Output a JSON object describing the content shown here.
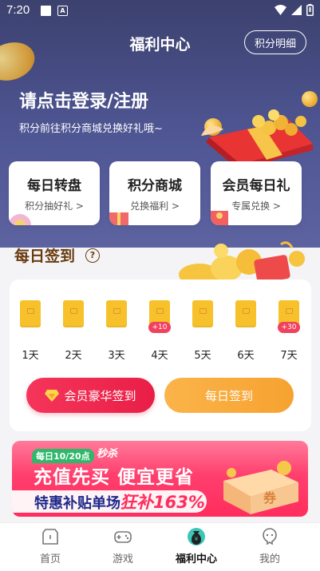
{
  "status": {
    "time": "7:20",
    "a_icon_letter": "A"
  },
  "header": {
    "title": "福利中心",
    "points_detail": "积分明细"
  },
  "login": {
    "title": "请点击登录/注册",
    "subtitle": "积分前往积分商城兑换好礼哦~"
  },
  "feature_cards": [
    {
      "title": "每日转盘",
      "sub": "积分抽好礼 >"
    },
    {
      "title": "积分商城",
      "sub": "兑换福利 >"
    },
    {
      "title": "会员每日礼",
      "sub": "专属兑换 >"
    }
  ],
  "signin": {
    "heading": "每日签到",
    "help_symbol": "?",
    "days": [
      {
        "label": "1天",
        "bonus": ""
      },
      {
        "label": "2天",
        "bonus": ""
      },
      {
        "label": "3天",
        "bonus": ""
      },
      {
        "label": "4天",
        "bonus": "+10"
      },
      {
        "label": "5天",
        "bonus": ""
      },
      {
        "label": "6天",
        "bonus": ""
      },
      {
        "label": "7天",
        "bonus": "+30"
      }
    ],
    "vip_button": "会员豪华签到",
    "daily_button": "每日签到"
  },
  "banner": {
    "tag_time": "每日10/20点",
    "tag_flash": "秒杀",
    "headline": "充值先买 便宜更省",
    "sub_a": "特惠补贴单场",
    "sub_b": "狂补163%",
    "box_text": "券"
  },
  "tabs": [
    {
      "label": "首页",
      "icon": "home-icon",
      "active": false
    },
    {
      "label": "游戏",
      "icon": "gamepad-icon",
      "active": false
    },
    {
      "label": "福利中心",
      "icon": "money-bag-icon",
      "active": true
    },
    {
      "label": "我的",
      "icon": "profile-icon",
      "active": false
    }
  ],
  "colors": {
    "hero": "#4f5694",
    "accent_red": "#e91e47",
    "accent_orange": "#f6a230",
    "signin_brown": "#6a3b0f"
  }
}
